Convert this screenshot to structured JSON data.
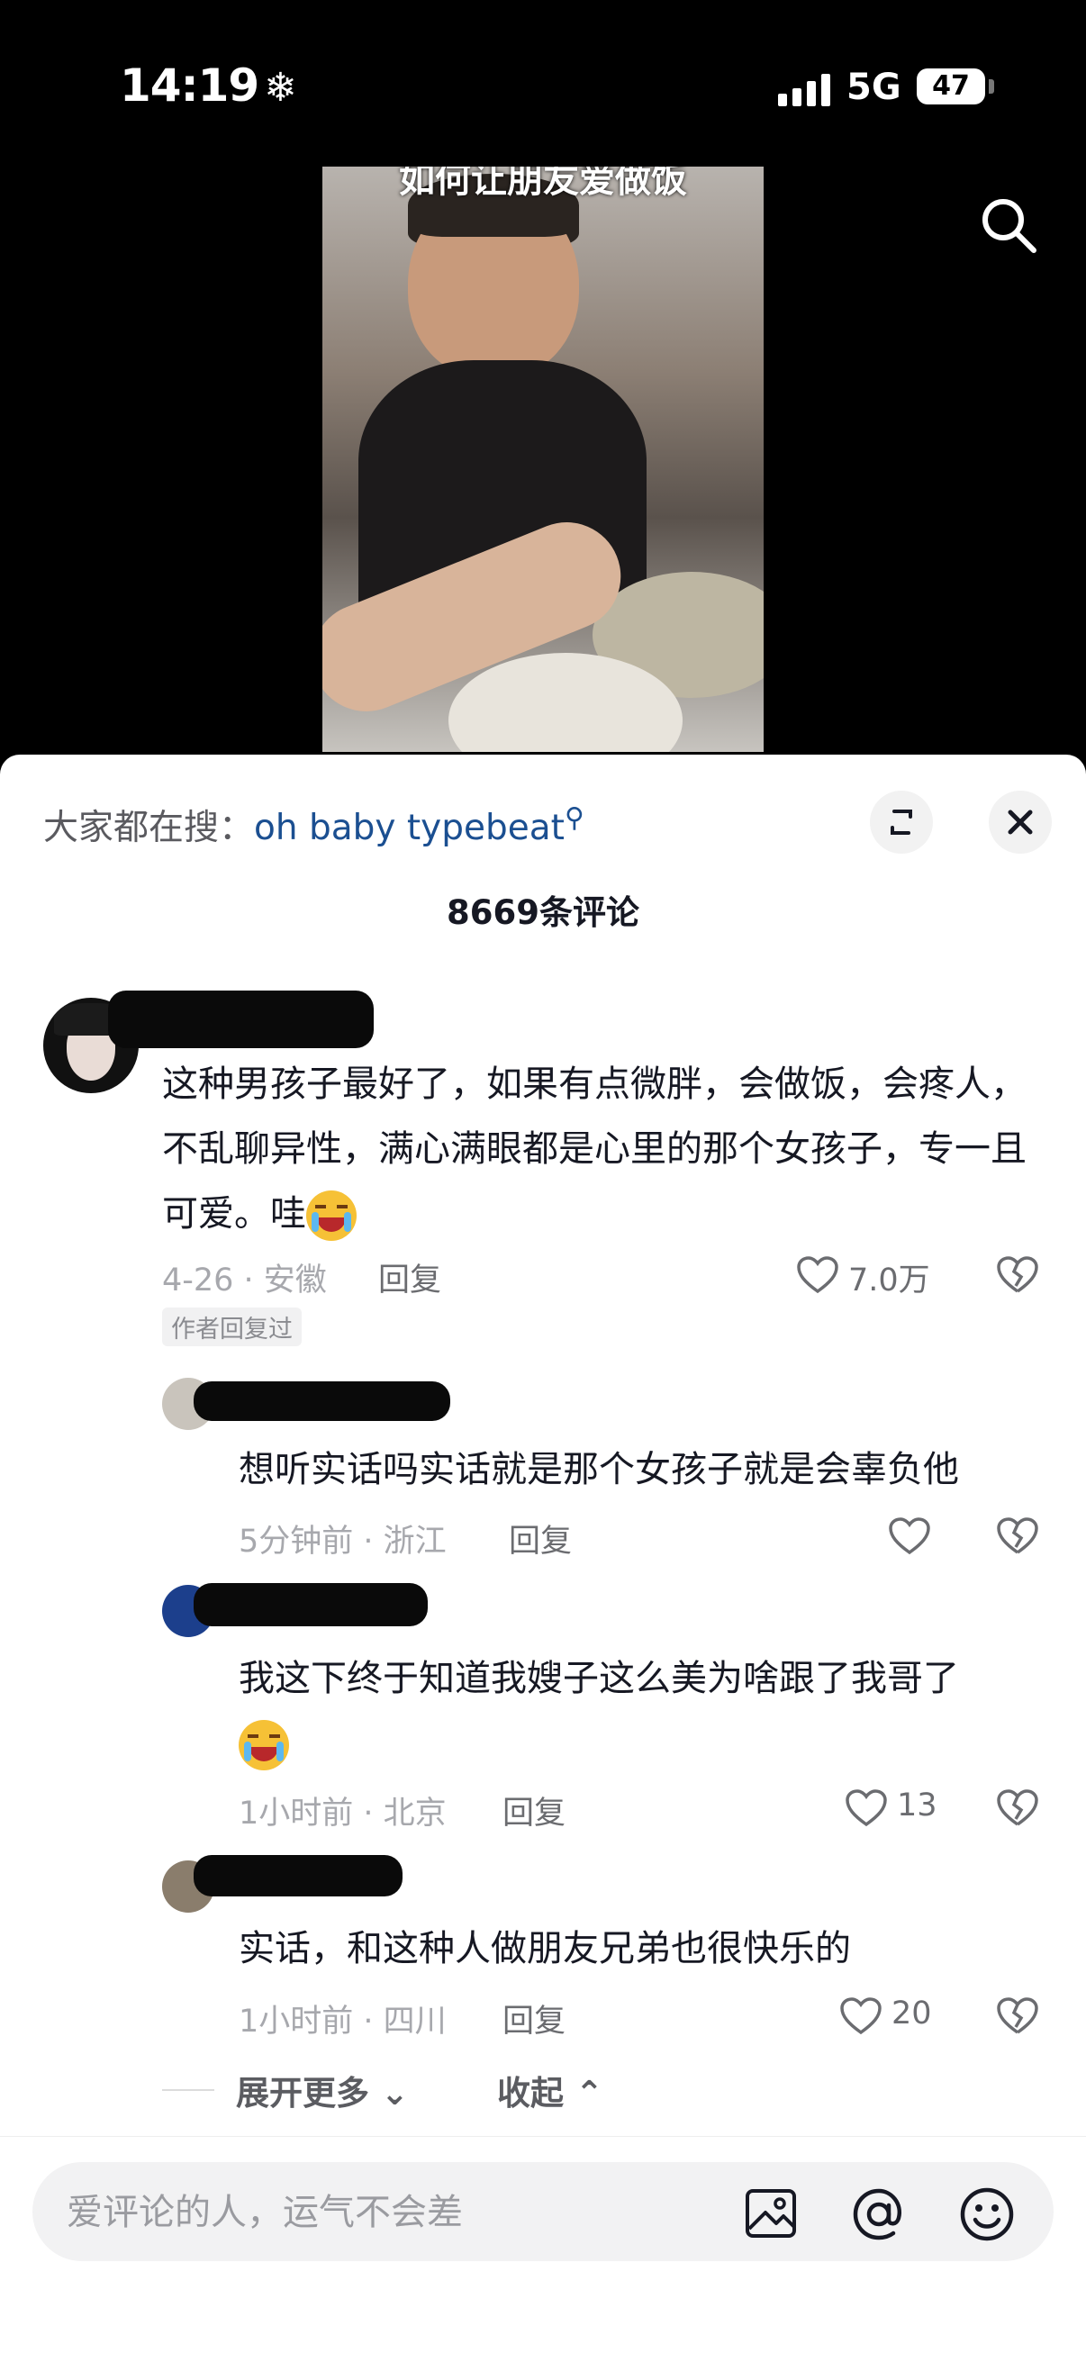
{
  "status_bar": {
    "time": "14:19",
    "time_icon": "❄",
    "network": "5G",
    "battery": "47"
  },
  "video": {
    "caption": "如何让朋友爱做饭"
  },
  "panel": {
    "hot_search_prefix": "大家都在搜：",
    "hot_search_keyword": "oh baby typebeat",
    "comment_count": "8669条评论"
  },
  "comments": [
    {
      "text": "这种男孩子最好了，如果有点微胖，会做饭，会疼人，不乱聊异性，满心满眼都是心里的那个女孩子，专一且可爱。哇",
      "meta": "4-26 · 安徽",
      "reply_label": "回复",
      "likes": "7.0万",
      "badge": "作者回复过"
    }
  ],
  "replies": [
    {
      "text": "想听实话吗实话就是那个女孩子就是会辜负他",
      "meta": "5分钟前 · 浙江",
      "reply_label": "回复",
      "likes": ""
    },
    {
      "text": "我这下终于知道我嫂子这么美为啥跟了我哥了",
      "meta": "1小时前 · 北京",
      "reply_label": "回复",
      "likes": "13"
    },
    {
      "text": "实话，和这种人做朋友兄弟也很快乐的",
      "meta": "1小时前 · 四川",
      "reply_label": "回复",
      "likes": "20"
    }
  ],
  "thread_controls": {
    "expand_label": "展开更多",
    "collapse_label": "收起"
  },
  "composer": {
    "placeholder": "爱评论的人，运气不会差"
  },
  "icons": [
    "search-icon",
    "expand-icon",
    "close-icon",
    "heart-icon",
    "dislike-icon",
    "image-icon",
    "at-icon",
    "emoji-icon"
  ]
}
